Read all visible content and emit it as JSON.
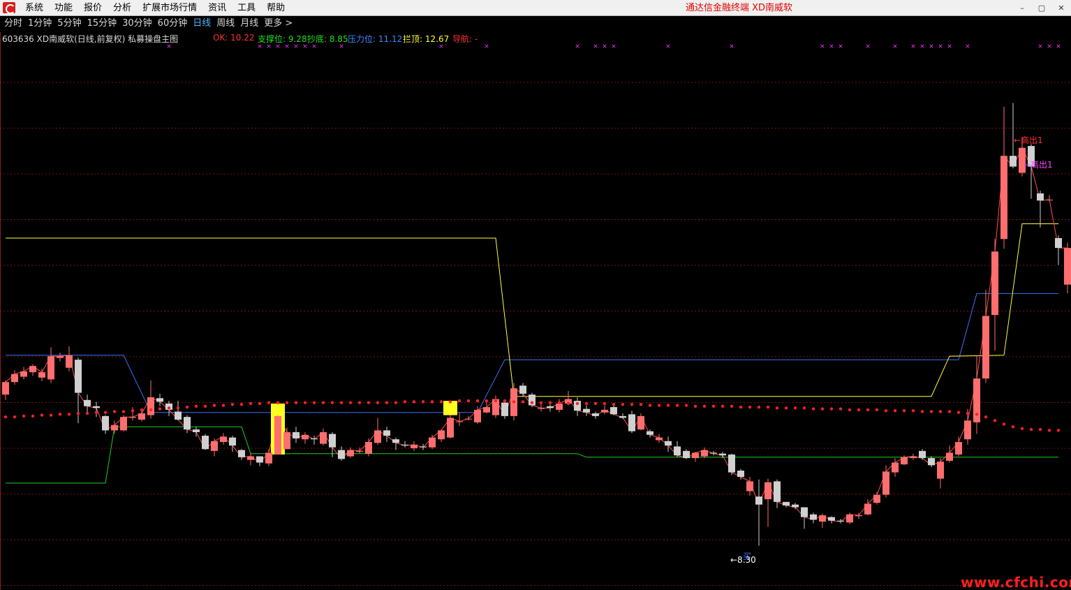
{
  "menubar": {
    "items": [
      "系统",
      "功能",
      "报价",
      "分析",
      "扩展市场行情",
      "资讯",
      "工具",
      "帮助"
    ],
    "terminal_title": "通达信金融终端  XD南威软",
    "controls": [
      "–",
      "▢",
      "✕"
    ]
  },
  "period_tabs": {
    "items": [
      "分时",
      "1分钟",
      "5分钟",
      "15分钟",
      "30分钟",
      "60分钟",
      "日线",
      "周线",
      "月线",
      "更多 >"
    ],
    "active": "日线"
  },
  "info": {
    "stock_title": "603636 XD南威软(日线,前复权) 私募操盘主图",
    "ok": "OK: 10.22",
    "support": "支撑位: 9.28",
    "bottom": "抄底: 8.85",
    "pressure": "压力位: 11.12",
    "top": "拦顶: 12.67",
    "nav": "导航: -"
  },
  "annotations": {
    "high_1": "←高出1",
    "high_2": "←高出1",
    "buy": "买",
    "low": "←8.30"
  },
  "watermark": "www.cfchi.com",
  "colors": {
    "up": "#ff6e6e",
    "down": "#d0d0d0",
    "support": "#20d020",
    "pressure": "#3b72ff",
    "top_line": "#ffff40",
    "red_dots": "#ff2020",
    "grid": "#7a1515",
    "marker_x": "#ff30ff",
    "highlight": "#ffff20"
  },
  "chart_data": {
    "type": "candlestick",
    "symbol": "603636",
    "y_range": [
      8.0,
      13.7
    ],
    "candles": [
      [
        9.99,
        10.13,
        10.15,
        9.93
      ],
      [
        10.13,
        10.22,
        10.26,
        10.1
      ],
      [
        10.19,
        10.25,
        10.3,
        10.16
      ],
      [
        10.24,
        10.31,
        10.33,
        10.2
      ],
      [
        10.18,
        10.24,
        10.28,
        10.14
      ],
      [
        10.16,
        10.42,
        10.52,
        10.12
      ],
      [
        10.4,
        10.42,
        10.46,
        10.36
      ],
      [
        10.29,
        10.43,
        10.53,
        10.25
      ],
      [
        10.38,
        10.01,
        10.4,
        9.67
      ],
      [
        9.93,
        9.86,
        9.99,
        9.79
      ],
      [
        9.86,
        9.84,
        9.91,
        9.74
      ],
      [
        9.75,
        9.59,
        9.76,
        9.55
      ],
      [
        9.59,
        9.65,
        9.7,
        9.55
      ],
      [
        9.59,
        9.74,
        9.76,
        9.58
      ],
      [
        9.73,
        9.74,
        9.85,
        9.7
      ],
      [
        9.71,
        9.78,
        9.83,
        9.69
      ],
      [
        9.76,
        9.96,
        10.15,
        9.72
      ],
      [
        9.95,
        9.91,
        10.0,
        9.86
      ],
      [
        9.89,
        9.82,
        9.92,
        9.75
      ],
      [
        9.8,
        9.71,
        9.92,
        9.7
      ],
      [
        9.74,
        9.6,
        9.76,
        9.56
      ],
      [
        9.6,
        9.57,
        9.63,
        9.52
      ],
      [
        9.53,
        9.38,
        9.55,
        9.37
      ],
      [
        9.36,
        9.47,
        9.5,
        9.3
      ],
      [
        9.46,
        9.52,
        9.56,
        9.43
      ],
      [
        9.51,
        9.42,
        9.53,
        9.35
      ],
      [
        9.37,
        9.29,
        9.38,
        9.26
      ],
      [
        9.26,
        9.3,
        9.34,
        9.2
      ],
      [
        9.3,
        9.23,
        9.29,
        9.19
      ],
      [
        9.22,
        9.34,
        9.38,
        9.19
      ],
      [
        9.32,
        9.75,
        9.76,
        9.35
      ],
      [
        9.38,
        9.57,
        9.62,
        9.38
      ],
      [
        9.57,
        9.5,
        9.63,
        9.45
      ],
      [
        9.49,
        9.54,
        9.57,
        9.44
      ],
      [
        9.5,
        9.49,
        9.53,
        9.43
      ],
      [
        9.44,
        9.57,
        9.61,
        9.42
      ],
      [
        9.55,
        9.4,
        9.57,
        9.29
      ],
      [
        9.37,
        9.27,
        9.41,
        9.25
      ],
      [
        9.3,
        9.37,
        9.4,
        9.28
      ],
      [
        9.35,
        9.36,
        9.4,
        9.33
      ],
      [
        9.33,
        9.46,
        9.5,
        9.3
      ],
      [
        9.45,
        9.59,
        9.73,
        9.43
      ],
      [
        9.59,
        9.53,
        9.63,
        9.46
      ],
      [
        9.49,
        9.45,
        9.51,
        9.37
      ],
      [
        9.43,
        9.42,
        9.47,
        9.4
      ],
      [
        9.39,
        9.43,
        9.47,
        9.36
      ],
      [
        9.41,
        9.4,
        9.44,
        9.37
      ],
      [
        9.4,
        9.51,
        9.54,
        9.38
      ],
      [
        9.49,
        9.59,
        9.6,
        9.46
      ],
      [
        9.51,
        9.73,
        9.76,
        9.5
      ],
      [
        9.69,
        9.69,
        9.79,
        9.64
      ],
      [
        9.72,
        9.72,
        9.75,
        9.7
      ],
      [
        9.68,
        9.82,
        9.86,
        9.66
      ],
      [
        9.79,
        9.85,
        9.92,
        9.78
      ],
      [
        9.76,
        9.94,
        9.98,
        9.73
      ],
      [
        9.9,
        9.75,
        9.92,
        9.72
      ],
      [
        9.75,
        10.06,
        10.12,
        9.7
      ],
      [
        10.09,
        10.0,
        10.12,
        9.97
      ],
      [
        9.99,
        9.87,
        10.01,
        9.85
      ],
      [
        9.83,
        9.84,
        9.89,
        9.8
      ],
      [
        9.86,
        9.84,
        9.88,
        9.8
      ],
      [
        9.82,
        9.89,
        9.94,
        9.79
      ],
      [
        9.89,
        9.94,
        10.03,
        9.87
      ],
      [
        9.92,
        9.81,
        9.96,
        9.75
      ],
      [
        9.83,
        9.79,
        9.87,
        9.75
      ],
      [
        9.78,
        9.75,
        9.8,
        9.72
      ],
      [
        9.79,
        9.82,
        9.87,
        9.77
      ],
      [
        9.85,
        9.77,
        9.89,
        9.76
      ],
      [
        9.75,
        9.73,
        9.78,
        9.72
      ],
      [
        9.77,
        9.58,
        9.81,
        9.56
      ],
      [
        9.6,
        9.75,
        9.78,
        9.59
      ],
      [
        9.58,
        9.54,
        9.6,
        9.51
      ],
      [
        9.48,
        9.51,
        9.55,
        9.45
      ],
      [
        9.47,
        9.42,
        9.52,
        9.35
      ],
      [
        9.41,
        9.31,
        9.47,
        9.29
      ],
      [
        9.36,
        9.28,
        9.38,
        9.27
      ],
      [
        9.28,
        9.34,
        9.35,
        9.24
      ],
      [
        9.3,
        9.37,
        9.4,
        9.28
      ],
      [
        9.34,
        9.33,
        9.36,
        9.31
      ],
      [
        9.33,
        9.31,
        9.35,
        9.28
      ],
      [
        9.32,
        9.12,
        9.33,
        9.09
      ],
      [
        9.14,
        9.07,
        9.16,
        9.04
      ],
      [
        8.91,
        9.02,
        9.07,
        8.86
      ],
      [
        8.85,
        8.76,
        9.04,
        8.3
      ],
      [
        8.82,
        9.01,
        9.05,
        8.51
      ],
      [
        9.02,
        8.79,
        9.04,
        8.72
      ],
      [
        8.79,
        8.75,
        8.79,
        8.73
      ],
      [
        8.76,
        8.73,
        8.78,
        8.71
      ],
      [
        8.73,
        8.62,
        8.73,
        8.49
      ],
      [
        8.65,
        8.59,
        8.67,
        8.55
      ],
      [
        8.57,
        8.64,
        8.66,
        8.5
      ],
      [
        8.62,
        8.58,
        8.63,
        8.55
      ],
      [
        8.58,
        8.57,
        8.6,
        8.55
      ],
      [
        8.56,
        8.65,
        8.67,
        8.54
      ],
      [
        8.63,
        8.64,
        8.67,
        8.6
      ],
      [
        8.65,
        8.77,
        8.82,
        8.64
      ],
      [
        8.78,
        8.87,
        8.9,
        8.76
      ],
      [
        8.87,
        9.13,
        9.2,
        8.84
      ],
      [
        9.12,
        9.23,
        9.28,
        9.07
      ],
      [
        9.21,
        9.29,
        9.31,
        9.2
      ],
      [
        9.28,
        9.3,
        9.33,
        9.26
      ],
      [
        9.36,
        9.28,
        9.38,
        9.26
      ],
      [
        9.28,
        9.2,
        9.3,
        9.18
      ],
      [
        9.05,
        9.24,
        9.28,
        8.94
      ],
      [
        9.25,
        9.34,
        9.42,
        9.23
      ],
      [
        9.32,
        9.46,
        9.52,
        9.3
      ],
      [
        9.49,
        9.7,
        9.83,
        9.43
      ],
      [
        9.68,
        10.17,
        10.43,
        9.55
      ],
      [
        10.17,
        10.87,
        11.16,
        10.12
      ],
      [
        10.88,
        11.59,
        11.73,
        10.48
      ],
      [
        11.73,
        12.66,
        13.21,
        11.62
      ],
      [
        12.66,
        12.54,
        13.25,
        12.52
      ],
      [
        12.47,
        12.75,
        12.86,
        12.43
      ],
      [
        12.77,
        12.54,
        12.79,
        12.18
      ],
      [
        12.24,
        12.16,
        12.27,
        11.86
      ],
      [
        12.17,
        12.17,
        12.22,
        12.15
      ],
      [
        11.74,
        11.63,
        11.77,
        11.44
      ],
      [
        11.22,
        11.63,
        11.69,
        11.12
      ]
    ],
    "support_steps": [
      [
        0,
        9.0
      ],
      [
        11,
        9.0
      ],
      [
        12,
        9.63
      ],
      [
        26,
        9.63
      ],
      [
        27,
        9.33
      ],
      [
        60,
        9.33
      ],
      [
        61,
        9.33
      ],
      [
        63,
        9.33
      ],
      [
        64,
        9.29
      ],
      [
        116,
        9.29
      ]
    ],
    "pressure_steps": [
      [
        0,
        10.43
      ],
      [
        13,
        10.43
      ],
      [
        16,
        9.79
      ],
      [
        52,
        9.79
      ],
      [
        55,
        10.38
      ],
      [
        105,
        10.38
      ],
      [
        107,
        11.12
      ],
      [
        116,
        11.12
      ]
    ],
    "top_steps": [
      [
        0,
        11.74
      ],
      [
        54,
        11.74
      ],
      [
        56,
        9.97
      ],
      [
        102,
        9.97
      ],
      [
        104,
        10.42
      ],
      [
        110,
        10.43
      ],
      [
        112,
        11.9
      ],
      [
        116,
        11.9
      ]
    ],
    "red_dots": [
      9.74,
      9.74,
      9.75,
      9.75,
      9.76,
      9.76,
      9.77,
      9.77,
      9.78,
      9.78,
      9.79,
      9.79,
      9.8,
      9.8,
      9.81,
      9.82,
      9.82,
      9.83,
      9.84,
      9.84,
      9.85,
      9.86,
      9.86,
      9.87,
      9.87,
      9.88,
      9.88,
      9.89,
      9.89,
      9.9,
      9.9,
      9.9,
      9.9,
      9.9,
      9.9,
      9.9,
      9.9,
      9.9,
      9.9,
      9.9,
      9.9,
      9.9,
      9.9,
      9.9,
      9.91,
      9.91,
      9.91,
      9.91,
      9.91,
      9.91,
      9.92,
      9.92,
      9.92,
      9.92,
      9.92,
      9.92,
      9.91,
      9.91,
      9.9,
      9.9,
      9.9,
      9.9,
      9.89,
      9.89,
      9.89,
      9.89,
      9.89,
      9.88,
      9.88,
      9.88,
      9.88,
      9.87,
      9.87,
      9.87,
      9.87,
      9.87,
      9.86,
      9.86,
      9.86,
      9.86,
      9.86,
      9.85,
      9.85,
      9.85,
      9.85,
      9.84,
      9.84,
      9.84,
      9.84,
      9.83,
      9.83,
      9.83,
      9.83,
      9.82,
      9.82,
      9.82,
      9.82,
      9.81,
      9.81,
      9.81,
      9.81,
      9.8,
      9.8,
      9.8,
      9.8,
      9.79,
      9.78,
      9.77,
      9.74,
      9.7,
      9.66,
      9.63,
      9.61,
      9.6,
      9.6,
      9.59,
      9.59
    ],
    "top_markers": [
      18,
      28,
      29,
      30,
      31,
      32,
      33,
      34,
      37,
      48,
      53,
      63,
      65,
      66,
      67,
      73,
      80,
      90,
      91,
      92,
      95,
      98,
      100,
      101,
      102,
      103,
      104,
      106,
      114,
      115,
      116,
      118,
      119
    ],
    "yellow_zones": [
      [
        30,
        9.89,
        9.32
      ],
      [
        49,
        9.92,
        9.76
      ]
    ]
  }
}
